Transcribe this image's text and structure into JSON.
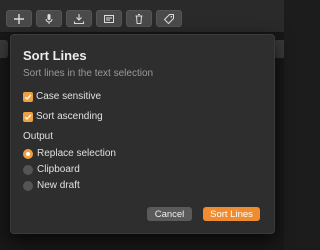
{
  "toolbar": {
    "icons": [
      "plus-icon",
      "microphone-icon",
      "download-icon",
      "card-icon",
      "trash-icon",
      "tag-icon"
    ]
  },
  "dialog": {
    "title": "Sort Lines",
    "subtitle": "Sort lines in the text selection",
    "options": {
      "case_sensitive": {
        "label": "Case sensitive",
        "checked": true
      },
      "sort_ascending": {
        "label": "Sort ascending",
        "checked": true
      }
    },
    "output": {
      "label": "Output",
      "choices": [
        {
          "label": "Replace selection",
          "selected": true
        },
        {
          "label": "Clipboard",
          "selected": false
        },
        {
          "label": "New draft",
          "selected": false
        }
      ]
    },
    "buttons": {
      "cancel": "Cancel",
      "confirm": "Sort Lines"
    }
  },
  "colors": {
    "accent": "#f08c30",
    "dialog_bg": "#2e2e2e"
  }
}
